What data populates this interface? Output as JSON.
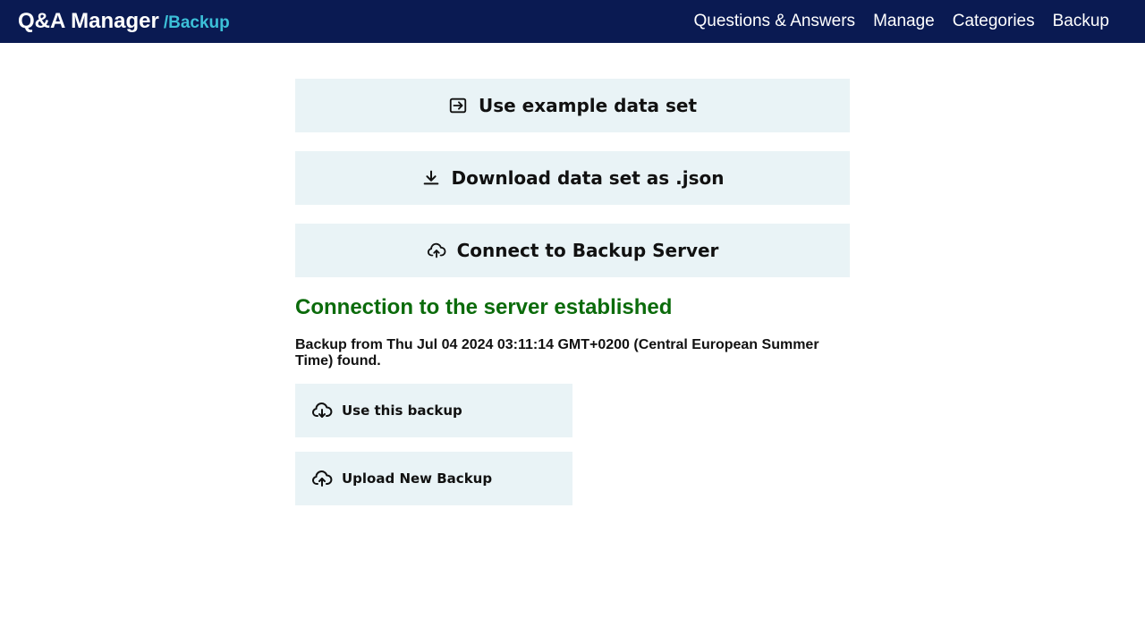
{
  "header": {
    "title": "Q&A Manager",
    "subtitle": "/Backup",
    "nav": [
      {
        "label": "Questions & Answers"
      },
      {
        "label": "Manage"
      },
      {
        "label": "Categories"
      },
      {
        "label": "Backup"
      }
    ]
  },
  "main": {
    "buttons": {
      "example": {
        "label": "Use example data set",
        "icon": "login-icon"
      },
      "download": {
        "label": "Download data set as .json",
        "icon": "download-icon"
      },
      "connect": {
        "label": "Connect to Backup Server",
        "icon": "cloud-upload-icon"
      }
    },
    "status": "Connection to the server established",
    "backup_info": "Backup from Thu Jul 04 2024 03:11:14 GMT+0200 (Central European Summer Time) found.",
    "use_backup": {
      "label": "Use this backup",
      "icon": "cloud-download-icon"
    },
    "upload_backup": {
      "label": "Upload New Backup",
      "icon": "cloud-upload-icon"
    }
  },
  "colors": {
    "header_bg": "#0a1a52",
    "accent": "#3cc0d8",
    "button_bg": "#e9f3f6",
    "success": "#0b6b0b"
  }
}
